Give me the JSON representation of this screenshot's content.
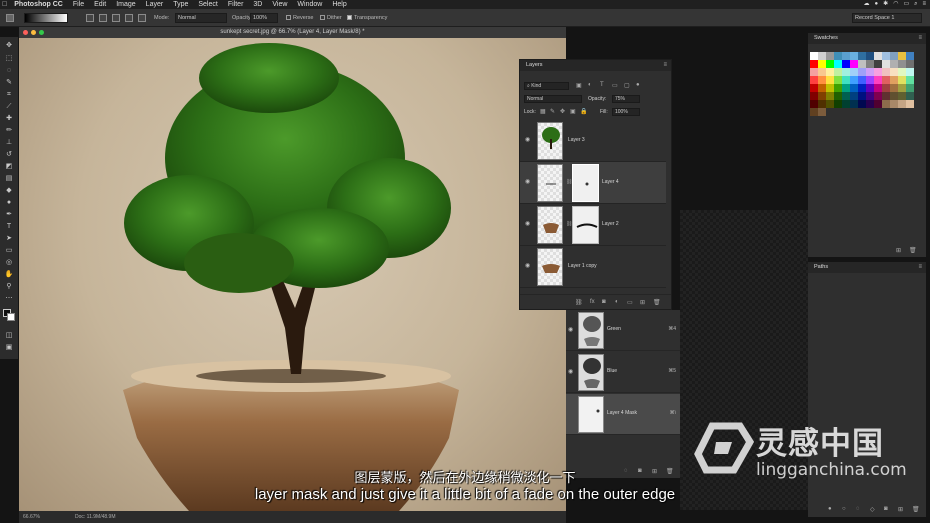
{
  "menubar": {
    "app": "Photoshop CC",
    "items": [
      "File",
      "Edit",
      "Image",
      "Layer",
      "Type",
      "Select",
      "Filter",
      "3D",
      "View",
      "Window",
      "Help"
    ]
  },
  "options": {
    "mode_label": "Mode:",
    "mode_value": "Normal",
    "opacity_label": "Opacity:",
    "opacity_value": "100%",
    "reverse_label": "Reverse",
    "dither_label": "Dither",
    "transparency_label": "Transparency",
    "workspace": "Record Space 1"
  },
  "document": {
    "title": "sunkept secret.jpg @ 66.7% (Layer 4, Layer Mask/8) *",
    "zoom": "66.67%",
    "doc_size": "Doc: 11.9M/48.9M"
  },
  "layers_panel": {
    "title": "Layers",
    "filter_kind": "Kind",
    "blend_mode": "Normal",
    "opacity_label": "Opacity:",
    "opacity_value": "75%",
    "lock_label": "Lock:",
    "fill_label": "Fill:",
    "fill_value": "100%",
    "layers": [
      {
        "name": "Layer 3"
      },
      {
        "name": "Layer 4"
      },
      {
        "name": "Layer 2"
      },
      {
        "name": "Layer 1 copy"
      }
    ]
  },
  "channels": [
    {
      "name": "Green",
      "shortcut": "⌘4"
    },
    {
      "name": "Blue",
      "shortcut": "⌘5"
    },
    {
      "name": "Layer 4 Mask",
      "shortcut": "⌘\\"
    }
  ],
  "swatches_panel": {
    "title": "Swatches",
    "colors": [
      "#ffffff",
      "#d0d0d0",
      "#999999",
      "#3f8fb8",
      "#5aa0d0",
      "#6ab0e0",
      "#2f6fa0",
      "#1f4f80",
      "#e0e0e0",
      "#a0c0e0",
      "#80a0c0",
      "#e8c040",
      "#4080c0",
      "#ff0000",
      "#ffff00",
      "#00ff00",
      "#00ffff",
      "#0000ff",
      "#ff00ff",
      "#c0c0c0",
      "#808080",
      "#404040",
      "#e0e0e0",
      "#b0b0b0",
      "#909090",
      "#707070",
      "#f4a0a0",
      "#f8c890",
      "#fff0a0",
      "#c0f0a0",
      "#a0f0e0",
      "#a0d0f8",
      "#a0a0f8",
      "#d0a0f8",
      "#f8a0e0",
      "#f0c0c0",
      "#f8e0c0",
      "#e0f8c0",
      "#c0f8f0",
      "#ff4040",
      "#ff9040",
      "#ffe040",
      "#80e040",
      "#40e0c0",
      "#40a0ff",
      "#4060ff",
      "#a040ff",
      "#ff40c0",
      "#e06060",
      "#e0a060",
      "#e0e060",
      "#60e0a0",
      "#c00000",
      "#c06000",
      "#c0c000",
      "#40a000",
      "#00a080",
      "#0060c0",
      "#0020c0",
      "#6000c0",
      "#c00080",
      "#a04040",
      "#a07040",
      "#a0a040",
      "#40a070",
      "#800000",
      "#804000",
      "#808000",
      "#206000",
      "#006050",
      "#004080",
      "#001080",
      "#400080",
      "#800050",
      "#603030",
      "#605030",
      "#606030",
      "#306050",
      "#500000",
      "#503000",
      "#505000",
      "#104000",
      "#004030",
      "#003050",
      "#000850",
      "#280050",
      "#500030",
      "#8c6c4c",
      "#a88868",
      "#c4a484",
      "#e0c0a0",
      "#604020",
      "#7c5c3c"
    ],
    "extra_label": ""
  },
  "paths_panel": {
    "title": "Paths"
  },
  "subtitles": {
    "chinese": "图层蒙版，然后在外边缘稍微淡化一下",
    "english": "layer mask and just give it a little bit of a fade on the outer edge"
  },
  "watermark": {
    "brand_cn": "灵感中国",
    "url": "lingganchina.com"
  }
}
